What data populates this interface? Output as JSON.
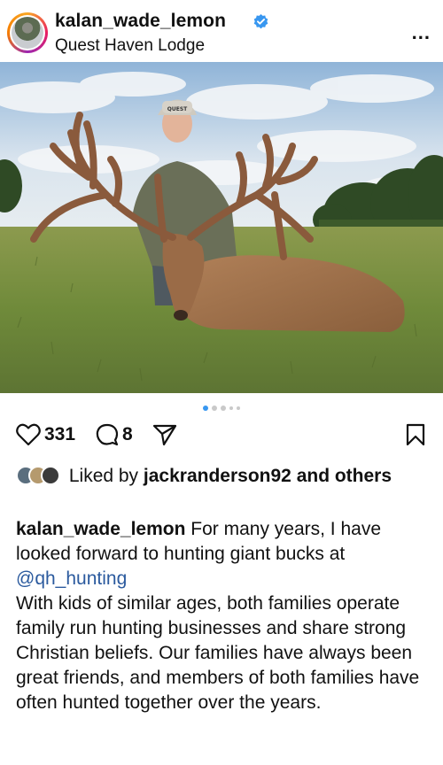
{
  "header": {
    "username": "kalan_wade_lemon",
    "location": "Quest Haven Lodge",
    "more_label": "..."
  },
  "photo": {
    "description_icon": "photo-icon",
    "hat_text": "QUEST"
  },
  "carousel": {
    "count": 5,
    "active_index": 0
  },
  "actions": {
    "like_count": "331",
    "comment_count": "8"
  },
  "likes": {
    "prefix": "Liked by",
    "user": "jackranderson92",
    "suffix": "and others"
  },
  "caption": {
    "username": "kalan_wade_lemon",
    "text1": "For many years, I have looked forward to hunting giant bucks at",
    "mention": "@qh_hunting",
    "text2": "With kids of similar ages, both families operate family run hunting businesses and share strong Christian beliefs. Our families have always been great friends, and members of both families have often hunted together over the years."
  },
  "colors": {
    "accent": "#3897f0",
    "verified": "#3897f0",
    "mention": "#2b5a9e"
  }
}
